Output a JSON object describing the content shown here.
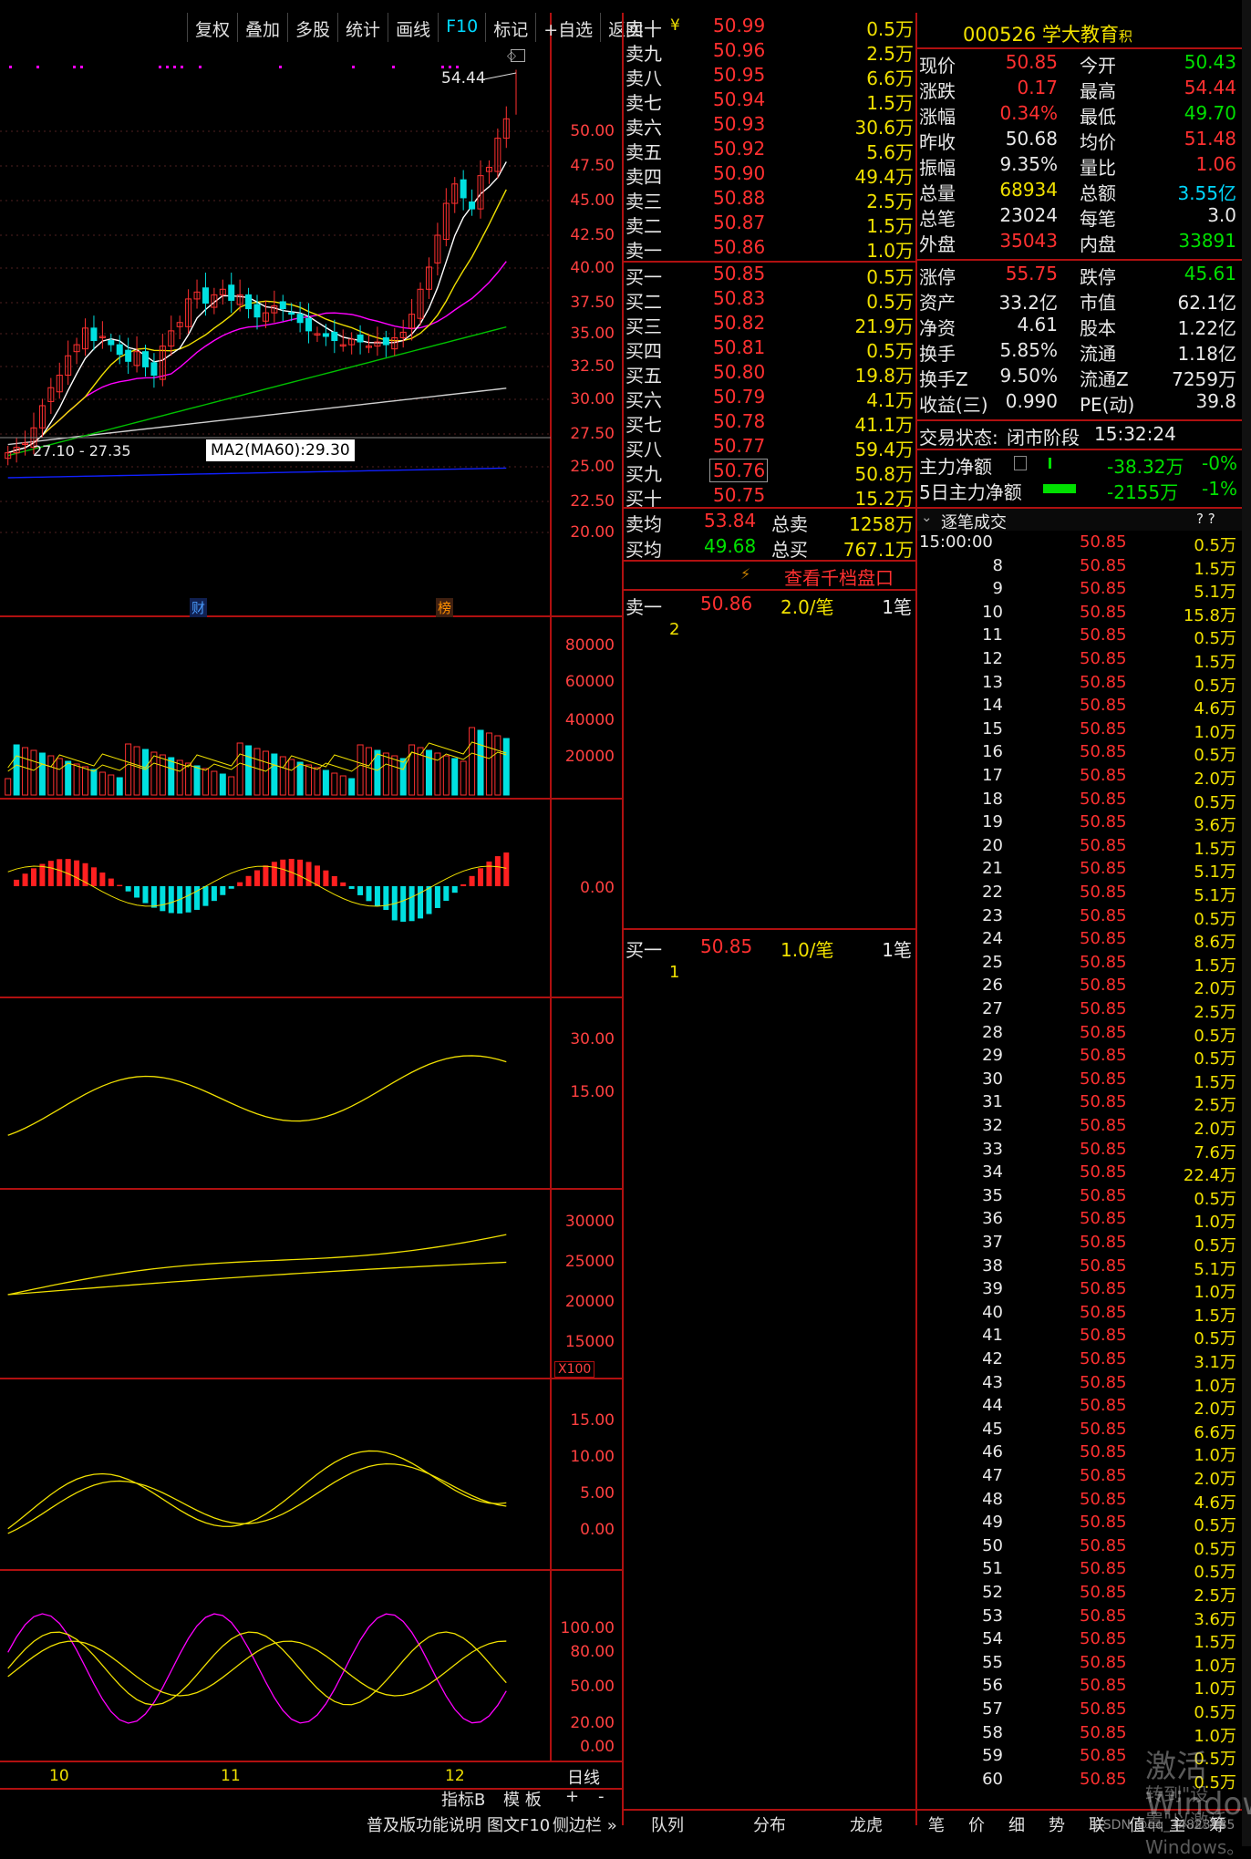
{
  "toolbar": [
    "复权",
    "叠加",
    "多股",
    "统计",
    "画线",
    "F10",
    "标记",
    "+自选",
    "返回"
  ],
  "chart": {
    "price_axis": [
      "50.00",
      "47.50",
      "45.00",
      "42.50",
      "40.00",
      "37.50",
      "35.00",
      "32.50",
      "30.00",
      "27.50",
      "25.00",
      "22.50",
      "20.00"
    ],
    "high_label": "54.44",
    "low_label": "27.10 - 27.35",
    "ma_tooltip": "MA2(MA60):29.30",
    "marker_cai": "财",
    "marker_bang": "榜",
    "vol_axis": [
      "80000",
      "60000",
      "40000",
      "20000"
    ],
    "macd_axis": [
      "0.00"
    ],
    "ind3_axis": [
      "30.00",
      "15.00"
    ],
    "ind4_axis": [
      "30000",
      "25000",
      "20000",
      "15000"
    ],
    "ind4_unit": "X100",
    "ind5_axis": [
      "15.00",
      "10.00",
      "5.00",
      "0.00"
    ],
    "ind6_axis": [
      "100.00",
      "80.00",
      "50.00",
      "20.00",
      "0.00"
    ],
    "month_labels": [
      "10",
      "11",
      "12"
    ],
    "period": "日线"
  },
  "bottom_left": {
    "tab1": "指标B",
    "tab2": "模 板",
    "plus": "+",
    "minus": "-",
    "help": "普及版功能说明",
    "f10": "图文F10",
    "sidebar": "侧边栏 »"
  },
  "orderbook": {
    "asks": [
      {
        "label": "卖十",
        "price": "50.99",
        "vol": "0.5万"
      },
      {
        "label": "卖九",
        "price": "50.96",
        "vol": "2.5万"
      },
      {
        "label": "卖八",
        "price": "50.95",
        "vol": "6.6万"
      },
      {
        "label": "卖七",
        "price": "50.94",
        "vol": "1.5万"
      },
      {
        "label": "卖六",
        "price": "50.93",
        "vol": "30.6万"
      },
      {
        "label": "卖五",
        "price": "50.92",
        "vol": "5.6万"
      },
      {
        "label": "卖四",
        "price": "50.90",
        "vol": "49.4万"
      },
      {
        "label": "卖三",
        "price": "50.88",
        "vol": "2.5万"
      },
      {
        "label": "卖二",
        "price": "50.87",
        "vol": "1.5万"
      },
      {
        "label": "卖一",
        "price": "50.86",
        "vol": "1.0万"
      }
    ],
    "bids": [
      {
        "label": "买一",
        "price": "50.85",
        "vol": "0.5万"
      },
      {
        "label": "买二",
        "price": "50.83",
        "vol": "0.5万"
      },
      {
        "label": "买三",
        "price": "50.82",
        "vol": "21.9万"
      },
      {
        "label": "买四",
        "price": "50.81",
        "vol": "0.5万"
      },
      {
        "label": "买五",
        "price": "50.80",
        "vol": "19.8万"
      },
      {
        "label": "买六",
        "price": "50.79",
        "vol": "4.1万"
      },
      {
        "label": "买七",
        "price": "50.78",
        "vol": "41.1万"
      },
      {
        "label": "买八",
        "price": "50.77",
        "vol": "59.4万"
      },
      {
        "label": "买九",
        "price": "50.76",
        "vol": "50.8万"
      },
      {
        "label": "买十",
        "price": "50.75",
        "vol": "15.2万"
      }
    ],
    "yen": "¥",
    "sell_avg_label": "卖均",
    "sell_avg": "53.84",
    "total_sell_label": "总卖",
    "total_sell": "1258万",
    "buy_avg_label": "买均",
    "buy_avg": "49.68",
    "total_buy_label": "总买",
    "total_buy": "767.1万",
    "view_depth": "查看千档盘口",
    "queue_ask": {
      "label": "卖一",
      "price": "50.86",
      "per": "2.0/笔",
      "count": "1笔",
      "items": [
        "2"
      ]
    },
    "queue_bid": {
      "label": "买一",
      "price": "50.85",
      "per": "1.0/笔",
      "count": "1笔",
      "items": [
        "1"
      ]
    },
    "tabs": [
      "队列",
      "分布",
      "龙虎"
    ]
  },
  "quote": {
    "code": "000526",
    "name": "学大教育",
    "tag": "积",
    "rows": [
      [
        "现价",
        "50.85",
        "今开",
        "50.43"
      ],
      [
        "涨跌",
        "0.17",
        "最高",
        "54.44"
      ],
      [
        "涨幅",
        "0.34%",
        "最低",
        "49.70"
      ],
      [
        "昨收",
        "50.68",
        "均价",
        "51.48"
      ],
      [
        "振幅",
        "9.35%",
        "量比",
        "1.06"
      ],
      [
        "总量",
        "68934",
        "总额",
        "3.55亿"
      ],
      [
        "总笔",
        "23024",
        "每笔",
        "3.0"
      ],
      [
        "外盘",
        "35043",
        "内盘",
        "33891"
      ]
    ],
    "rows2": [
      [
        "涨停",
        "55.75",
        "跌停",
        "45.61"
      ],
      [
        "资产",
        "33.2亿",
        "市值",
        "62.1亿"
      ],
      [
        "净资",
        "4.61",
        "股本",
        "1.22亿"
      ],
      [
        "换手",
        "5.85%",
        "流通",
        "1.18亿"
      ],
      [
        "换手Z",
        "9.50%",
        "流通Z",
        "7259万"
      ],
      [
        "收益(三)",
        "0.990",
        "PE(动)",
        "39.8"
      ]
    ],
    "status_label": "交易状态:",
    "status": "闭市阶段",
    "status_time": "15:32:24",
    "flow1_label": "主力净额",
    "flow1": "-38.32万",
    "flow1_pct": "-0%",
    "flow2_label": "5日主力净额",
    "flow2": "-2155万",
    "flow2_pct": "-1%",
    "ticks_title": "逐笔成交",
    "ticks_help": "? ?",
    "ticks": [
      [
        "15:00:00",
        "50.85",
        "0.5万"
      ],
      [
        "8",
        "50.85",
        "1.5万"
      ],
      [
        "9",
        "50.85",
        "5.1万"
      ],
      [
        "10",
        "50.85",
        "15.8万"
      ],
      [
        "11",
        "50.85",
        "0.5万"
      ],
      [
        "12",
        "50.85",
        "1.5万"
      ],
      [
        "13",
        "50.85",
        "0.5万"
      ],
      [
        "14",
        "50.85",
        "4.6万"
      ],
      [
        "15",
        "50.85",
        "1.0万"
      ],
      [
        "16",
        "50.85",
        "0.5万"
      ],
      [
        "17",
        "50.85",
        "2.0万"
      ],
      [
        "18",
        "50.85",
        "0.5万"
      ],
      [
        "19",
        "50.85",
        "3.6万"
      ],
      [
        "20",
        "50.85",
        "1.5万"
      ],
      [
        "21",
        "50.85",
        "5.1万"
      ],
      [
        "22",
        "50.85",
        "5.1万"
      ],
      [
        "23",
        "50.85",
        "0.5万"
      ],
      [
        "24",
        "50.85",
        "8.6万"
      ],
      [
        "25",
        "50.85",
        "1.5万"
      ],
      [
        "26",
        "50.85",
        "2.0万"
      ],
      [
        "27",
        "50.85",
        "2.5万"
      ],
      [
        "28",
        "50.85",
        "0.5万"
      ],
      [
        "29",
        "50.85",
        "0.5万"
      ],
      [
        "30",
        "50.85",
        "1.5万"
      ],
      [
        "31",
        "50.85",
        "2.5万"
      ],
      [
        "32",
        "50.85",
        "2.0万"
      ],
      [
        "33",
        "50.85",
        "7.6万"
      ],
      [
        "34",
        "50.85",
        "22.4万"
      ],
      [
        "35",
        "50.85",
        "0.5万"
      ],
      [
        "36",
        "50.85",
        "1.0万"
      ],
      [
        "37",
        "50.85",
        "0.5万"
      ],
      [
        "38",
        "50.85",
        "5.1万"
      ],
      [
        "39",
        "50.85",
        "1.0万"
      ],
      [
        "40",
        "50.85",
        "1.5万"
      ],
      [
        "41",
        "50.85",
        "0.5万"
      ],
      [
        "42",
        "50.85",
        "3.1万"
      ],
      [
        "43",
        "50.85",
        "1.0万"
      ],
      [
        "44",
        "50.85",
        "2.0万"
      ],
      [
        "45",
        "50.85",
        "6.6万"
      ],
      [
        "46",
        "50.85",
        "1.0万"
      ],
      [
        "47",
        "50.85",
        "2.0万"
      ],
      [
        "48",
        "50.85",
        "4.6万"
      ],
      [
        "49",
        "50.85",
        "0.5万"
      ],
      [
        "50",
        "50.85",
        "0.5万"
      ],
      [
        "51",
        "50.85",
        "0.5万"
      ],
      [
        "52",
        "50.85",
        "2.5万"
      ],
      [
        "53",
        "50.85",
        "3.6万"
      ],
      [
        "54",
        "50.85",
        "1.5万"
      ],
      [
        "55",
        "50.85",
        "1.0万"
      ],
      [
        "56",
        "50.85",
        "1.0万"
      ],
      [
        "57",
        "50.85",
        "0.5万"
      ],
      [
        "58",
        "50.85",
        "1.0万"
      ],
      [
        "59",
        "50.85",
        "0.5万"
      ],
      [
        "60",
        "50.85",
        "0.5万"
      ]
    ],
    "bottom_tabs": [
      "笔",
      "价",
      "细",
      "势",
      "联",
      "值",
      "主",
      "筹"
    ]
  },
  "watermark": "激活 Windows",
  "watermark2": "转到\"设置\"以激活 Windows。",
  "csdn": "CSDN @qq_34823185"
}
